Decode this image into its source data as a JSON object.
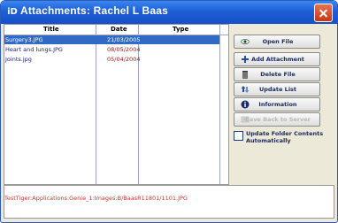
{
  "window": {
    "title": "Attachments: Rachel L Baas",
    "app_icon": "iD",
    "close_icon": "close-icon"
  },
  "list": {
    "columns": [
      "Title",
      "Date",
      "Type"
    ],
    "rows": [
      {
        "title": "Surgery3.JPG",
        "date": "21/03/2005",
        "type": "",
        "selected": true
      },
      {
        "title": "Heart and lungs.JPG",
        "date": "08/05/2004",
        "type": "",
        "selected": false
      },
      {
        "title": "Joints.jpg",
        "date": "05/04/2004",
        "type": "",
        "selected": false
      }
    ]
  },
  "actions": {
    "open_file": "Open File",
    "add_attachment": "Add Attachment",
    "delete_file": "Delete File",
    "update_list": "Update List",
    "information": "Information",
    "save_back": "Save Back to Server"
  },
  "options": {
    "update_folder": "Update Folder Contents Automatically"
  },
  "path": {
    "text": "TestTiger:Applications:Genie_1:Images:B/BaasR11801/1101.JPG"
  },
  "colors": {
    "selection": "#316ac5",
    "title_bar": "#1e5fd6",
    "path_text": "#c0392b",
    "date_text": "#8a1a1a"
  }
}
